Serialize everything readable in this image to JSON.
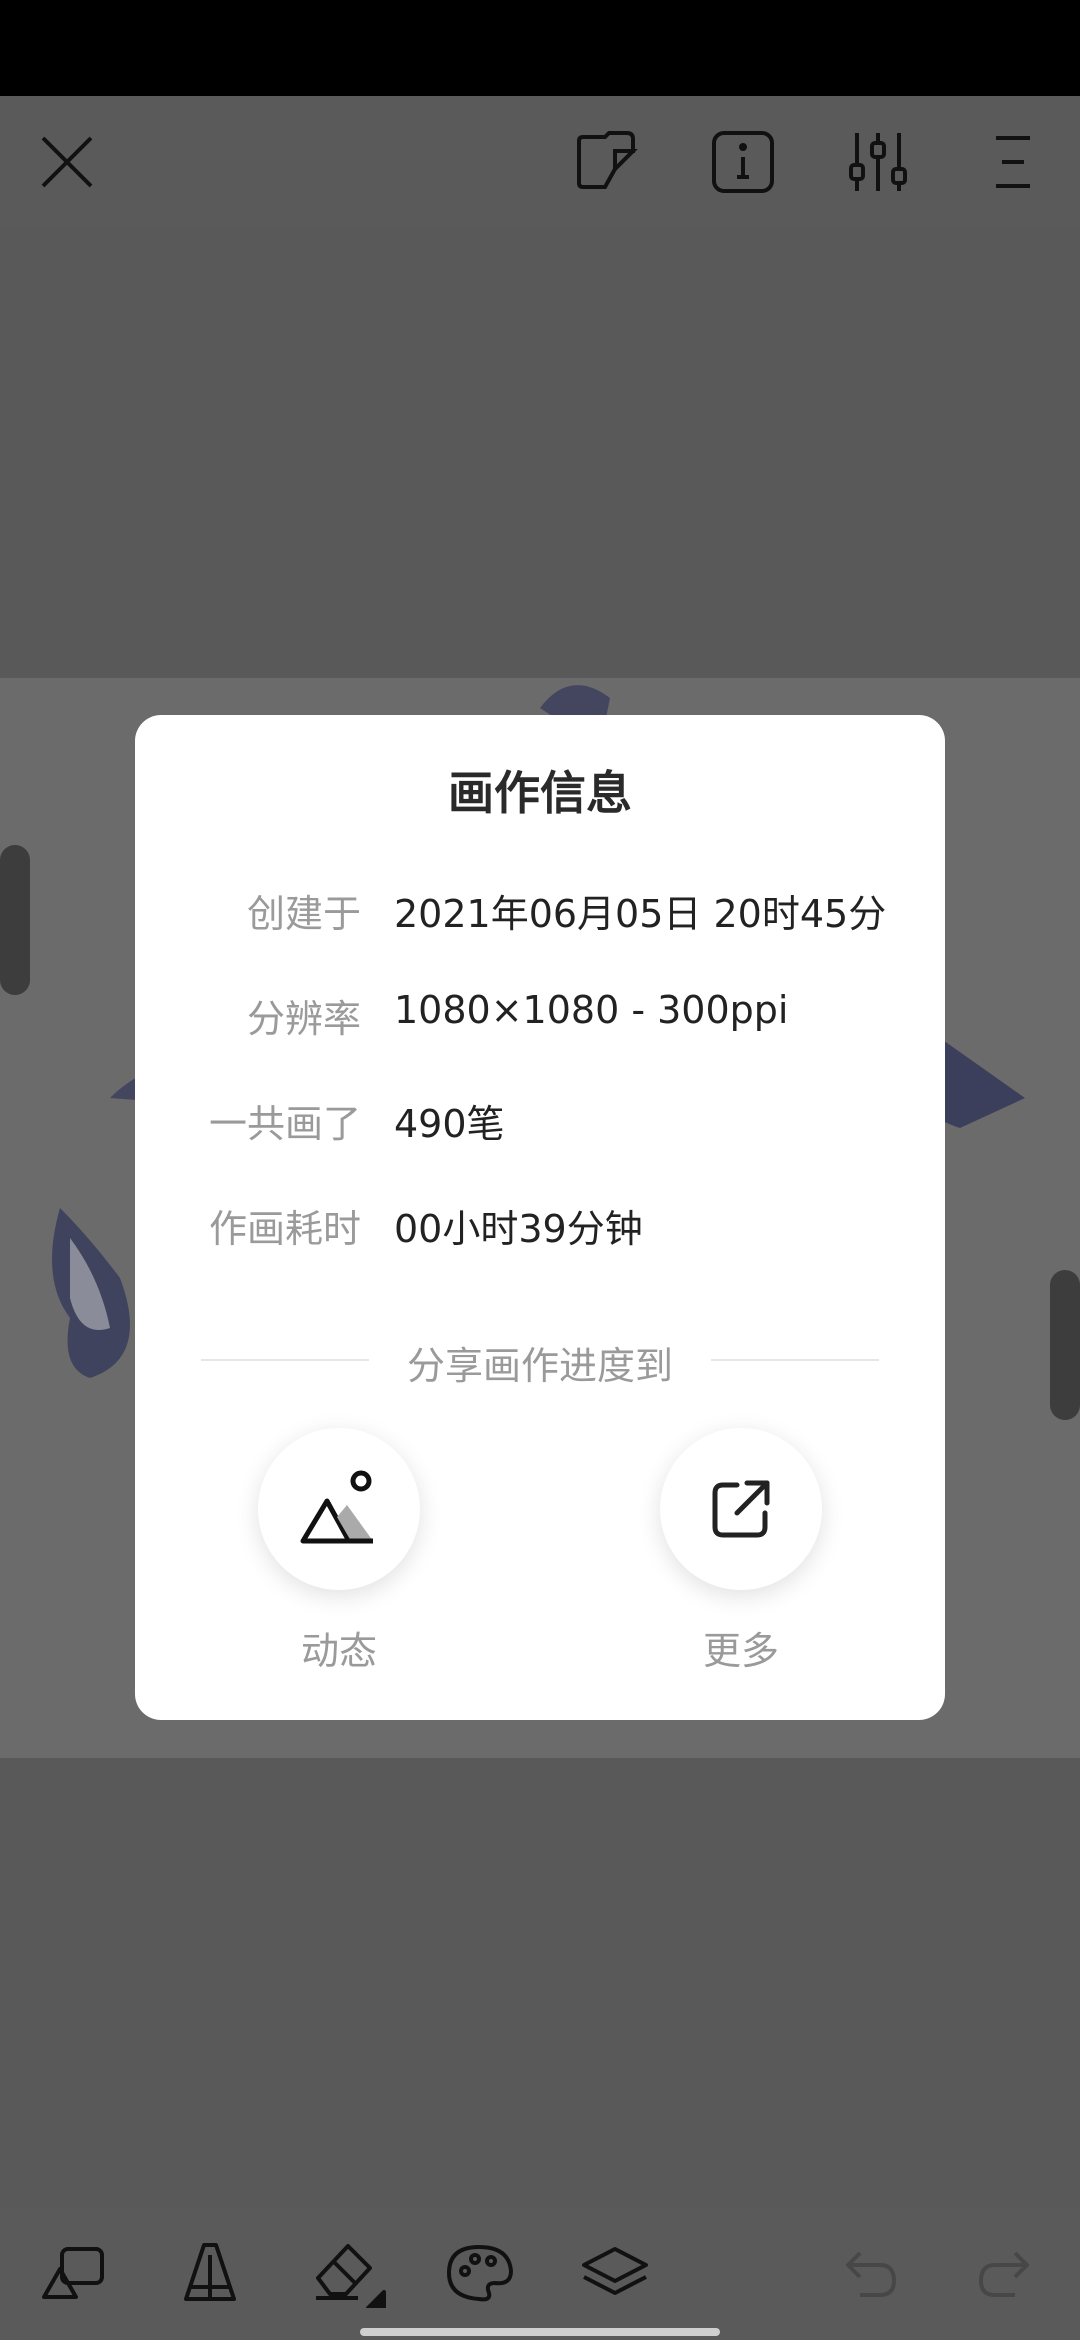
{
  "top_toolbar": {
    "icons": [
      "close-icon",
      "sticker-icon",
      "info-icon",
      "adjust-icon",
      "menu-icon"
    ]
  },
  "bottom_toolbar": {
    "icons": [
      "shapes-icon",
      "pen-icon",
      "eraser-icon",
      "palette-icon",
      "layers-icon",
      "undo-icon",
      "redo-icon"
    ]
  },
  "dialog": {
    "title": "画作信息",
    "rows": [
      {
        "label": "创建于",
        "value": "2021年06月05日 20时45分"
      },
      {
        "label": "分辨率",
        "value": "1080×1080 - 300ppi"
      },
      {
        "label": "一共画了",
        "value": "490笔"
      },
      {
        "label": "作画耗时",
        "value": "00小时39分钟"
      }
    ],
    "share_caption": "分享画作进度到",
    "share_options": [
      {
        "label": "动态",
        "icon": "mountain-image-icon"
      },
      {
        "label": "更多",
        "icon": "external-share-icon"
      }
    ]
  },
  "colors": {
    "overlay_bg": "#595959",
    "dialog_bg": "#ffffff",
    "label_gray": "#9a9a9a",
    "text_dark": "#222222",
    "drawing_navy": "#3c3f5c"
  }
}
